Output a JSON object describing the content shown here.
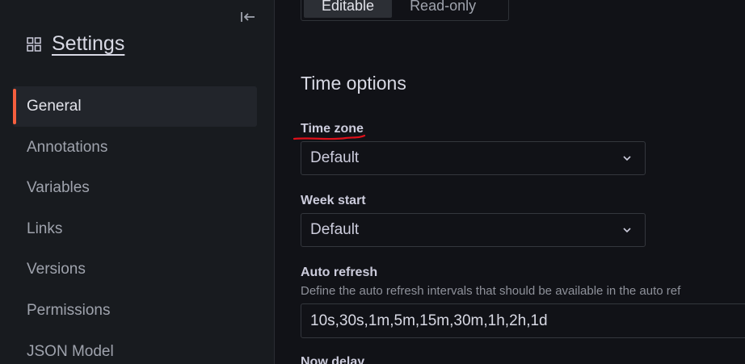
{
  "sidebar": {
    "title": "Settings",
    "items": [
      {
        "label": "General",
        "active": true
      },
      {
        "label": "Annotations",
        "active": false
      },
      {
        "label": "Variables",
        "active": false
      },
      {
        "label": "Links",
        "active": false
      },
      {
        "label": "Versions",
        "active": false
      },
      {
        "label": "Permissions",
        "active": false
      },
      {
        "label": "JSON Model",
        "active": false
      }
    ]
  },
  "editable_toggle": {
    "options": [
      "Editable",
      "Read-only"
    ],
    "selected": "Editable"
  },
  "time_options": {
    "title": "Time options",
    "time_zone": {
      "label": "Time zone",
      "value": "Default"
    },
    "week_start": {
      "label": "Week start",
      "value": "Default"
    },
    "auto_refresh": {
      "label": "Auto refresh",
      "description": "Define the auto refresh intervals that should be available in the auto ref",
      "value": "10s,30s,1m,5m,15m,30m,1h,2h,1d"
    },
    "now_delay": {
      "label": "Now delay"
    }
  },
  "colors": {
    "accent": "#f55f3e",
    "annotation": "#e0101a",
    "background": "#111217",
    "sidebar": "#181b1f"
  },
  "icons": {
    "collapse": "collapse-left-icon",
    "settings": "grid-icon",
    "chevron": "chevron-down-icon"
  }
}
